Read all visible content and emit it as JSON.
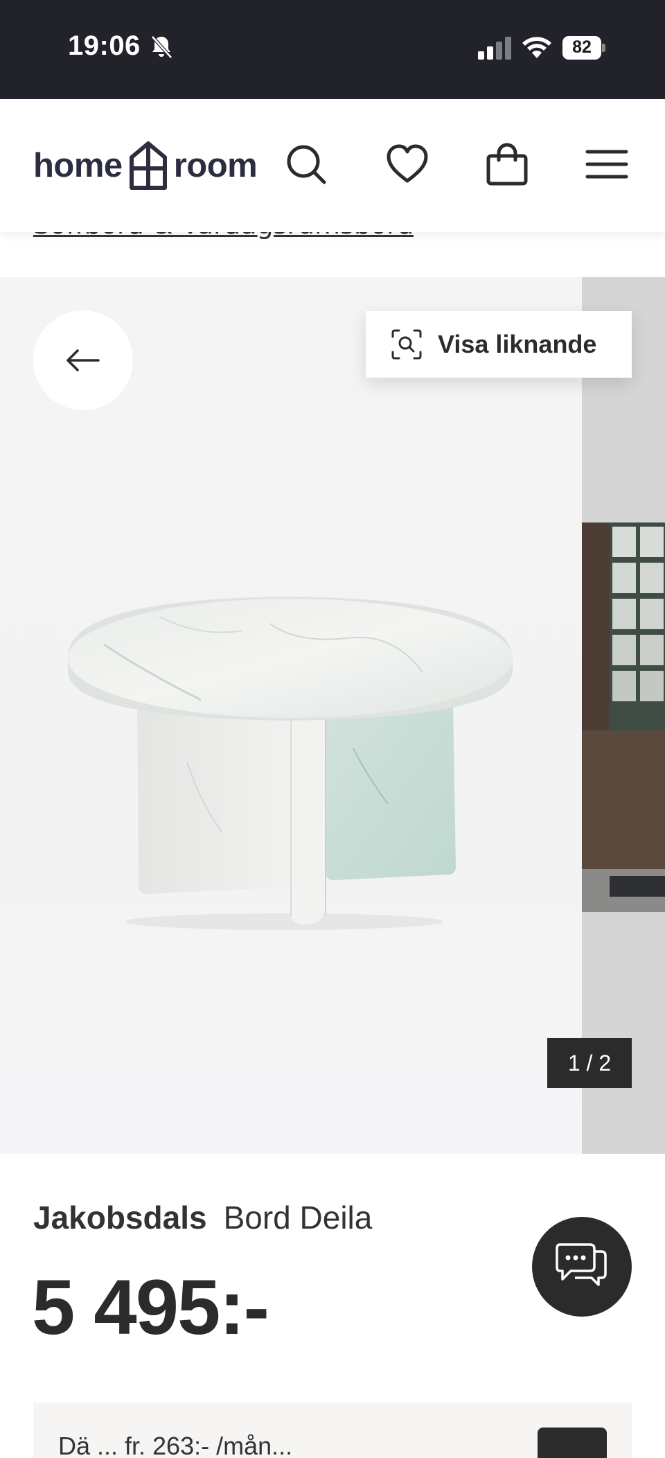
{
  "status_bar": {
    "time": "19:06",
    "battery": "82",
    "icons": [
      "bell-muted-icon",
      "signal-icon",
      "wifi-icon",
      "battery-icon"
    ]
  },
  "header": {
    "logo_word_1": "home",
    "logo_word_2": "room",
    "icons": [
      "search-icon",
      "heart-icon",
      "shopping-bag-icon",
      "menu-icon"
    ]
  },
  "breadcrumb_peek": "Soffbord & Vardagsrumsbord",
  "gallery": {
    "similar_label": "Visa liknande",
    "counter": "1 / 2"
  },
  "product": {
    "brand": "Jakobsdals",
    "name": "Bord Deila",
    "price": "5 495:-"
  },
  "promo": {
    "text": "Dä ... fr. 263:- /mån..."
  },
  "colors": {
    "status_bar_bg": "#22232a",
    "dark": "#2b2b2b",
    "logo": "#2d2d40",
    "gallery_bg": "#f4f4f4",
    "promo_bg": "#f6f5f3"
  }
}
